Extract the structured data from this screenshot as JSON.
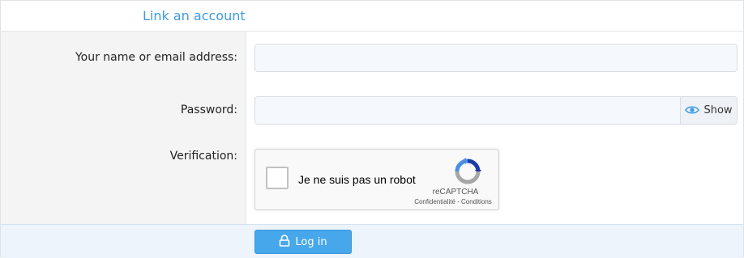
{
  "header": {
    "title": "Link an account"
  },
  "form": {
    "name_label": "Your name or email address:",
    "name_value": "",
    "password_label": "Password:",
    "password_value": "",
    "show_label": "Show",
    "verification_label": "Verification:"
  },
  "captcha": {
    "checkbox_text": "Je ne suis pas un robot",
    "brand": "reCAPTCHA",
    "links": "Confidentialité - Conditions",
    "checked": false
  },
  "footer": {
    "login_label": "Log in"
  },
  "colors": {
    "accent": "#3d9be3",
    "button_bg": "#47a7eb",
    "footer_bg": "#edf4fb",
    "label_col_bg": "#f4f4f4"
  },
  "icons": {
    "show": "eye-icon",
    "login": "lock-icon",
    "captcha": "recaptcha-logo-icon"
  }
}
